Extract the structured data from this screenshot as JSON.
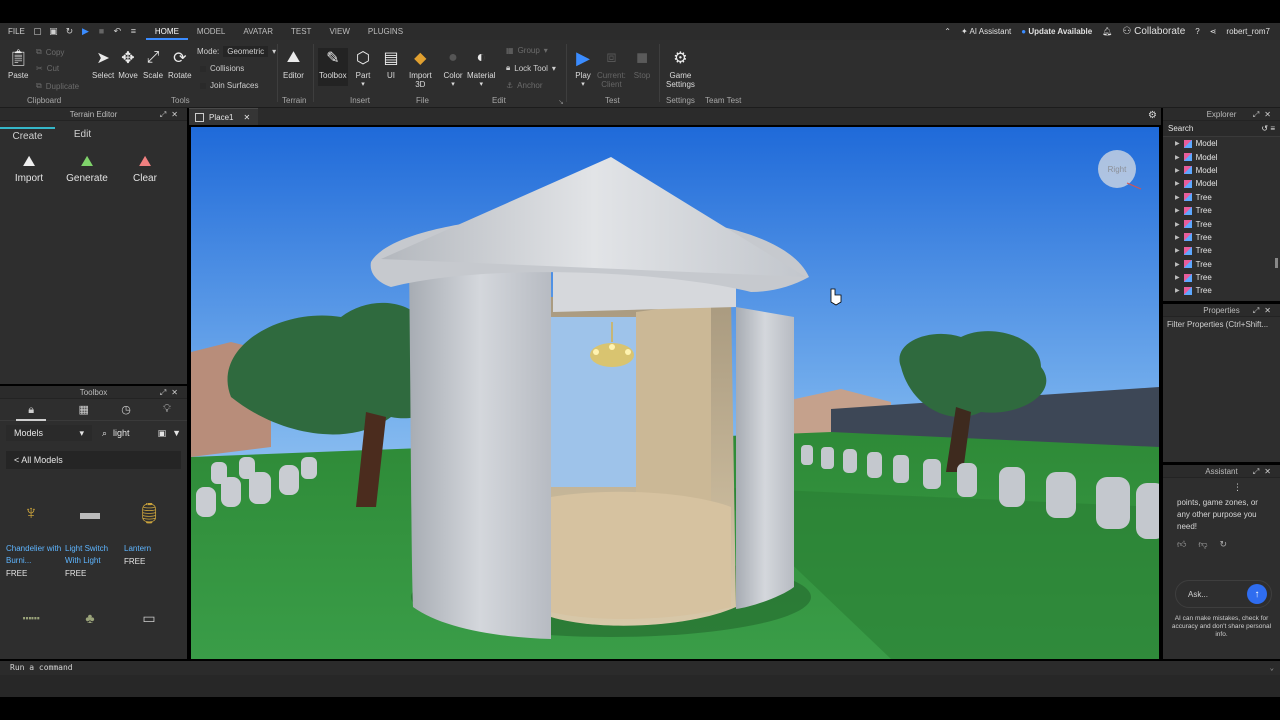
{
  "menubar": {
    "file": "FILE",
    "tabs": [
      "HOME",
      "MODEL",
      "AVATAR",
      "TEST",
      "VIEW",
      "PLUGINS"
    ],
    "ai_assistant": "AI Assistant",
    "update": "Update Available",
    "collaborate": "Collaborate",
    "user": "robert_rom7"
  },
  "ribbon": {
    "paste": "Paste",
    "copy": "Copy",
    "cut": "Cut",
    "duplicate": "Duplicate",
    "clipboard": "Clipboard",
    "select": "Select",
    "move": "Move",
    "scale": "Scale",
    "rotate": "Rotate",
    "mode_label": "Mode:",
    "mode_value": "Geometric",
    "collisions": "Collisions",
    "join_surfaces": "Join Surfaces",
    "tools": "Tools",
    "editor": "Editor",
    "terrain": "Terrain",
    "toolbox": "Toolbox",
    "part": "Part",
    "ui": "UI",
    "insert": "Insert",
    "import3d_1": "Import",
    "import3d_2": "3D",
    "file": "File",
    "color": "Color",
    "material": "Material",
    "group": "Group",
    "lock_tool": "Lock Tool",
    "anchor": "Anchor",
    "edit": "Edit",
    "play": "Play",
    "current_1": "Current:",
    "current_2": "Client",
    "stop": "Stop",
    "test": "Test",
    "game_settings_1": "Game",
    "game_settings_2": "Settings",
    "settings": "Settings",
    "team_test": "Team Test"
  },
  "terrain_editor": {
    "title": "Terrain Editor",
    "tabs": [
      "Create",
      "Edit"
    ],
    "tools": [
      "Import",
      "Generate",
      "Clear"
    ]
  },
  "toolbox": {
    "title": "Toolbox",
    "category": "Models",
    "search": "light",
    "all_models": "< All Models",
    "items": [
      {
        "name": "Chandelier with Burni...",
        "price": "FREE"
      },
      {
        "name": "Light Switch With Light",
        "price": "FREE"
      },
      {
        "name": "Lantern",
        "price": "FREE"
      }
    ]
  },
  "document": {
    "tab": "Place1",
    "view_cube": "Right"
  },
  "explorer": {
    "title": "Explorer",
    "search": "Search",
    "items": [
      "Model",
      "Model",
      "Model",
      "Model",
      "Tree",
      "Tree",
      "Tree",
      "Tree",
      "Tree",
      "Tree",
      "Tree",
      "Tree"
    ]
  },
  "properties": {
    "title": "Properties",
    "filter": "Filter Properties (Ctrl+Shift..."
  },
  "assistant": {
    "title": "Assistant",
    "message": "points, game zones, or any other purpose you need!",
    "placeholder": "Ask...",
    "disclaimer": "AI can make mistakes, check for accuracy and don't share personal info."
  },
  "command": {
    "placeholder": "Run a command"
  },
  "colors": {
    "accent": "#3b8cff",
    "terrain_tab": "#35b7c9",
    "link": "#5eb5ff",
    "send": "#2f6df0"
  }
}
